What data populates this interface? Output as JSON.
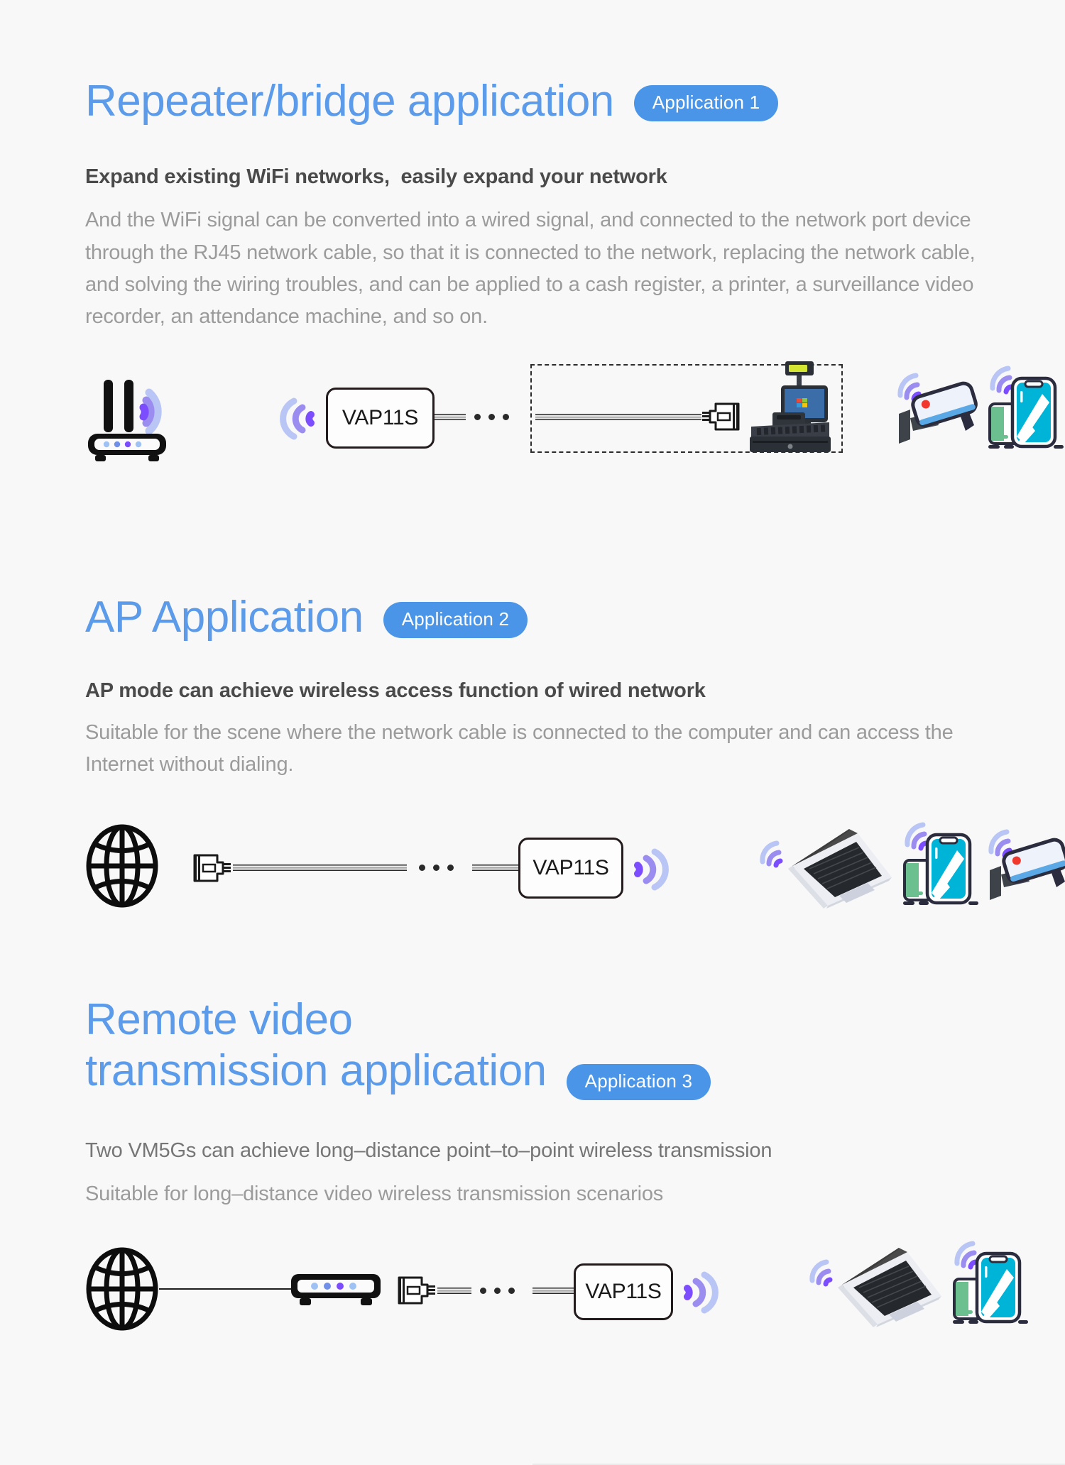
{
  "page": {
    "background": "#f8f8f8",
    "accent_blue": "#5b9bea",
    "badge_blue": "#4a95e8",
    "wifi_inner": "#7c4dff",
    "wifi_mid": "#9b8cf0",
    "wifi_outer": "#b8c5f5"
  },
  "sections": [
    {
      "id": "repeater-bridge",
      "title": "Repeater/bridge application",
      "badge": "Application 1",
      "subtitle": "Expand existing WiFi networks,  easily expand your network",
      "body": "And the WiFi signal can be converted into a wired signal, and connected to the network port device through the RJ45 network cable, so that it is connected to the network, replacing the network cable, and solving the wiring troubles, and can be applied to a cash register, a printer, a surveillance video recorder, an attendance machine, and so on.",
      "diagram": {
        "device_label": "VAP11S",
        "nodes": [
          "router-icon",
          "wifi-signal-icon",
          "vap11s-device",
          "ethernet-cable",
          "ellipsis-separator",
          "rj45-connector",
          "cash-register-icon",
          "cctv-camera-icon",
          "smartphone-icon"
        ]
      }
    },
    {
      "id": "ap-application",
      "title": "AP Application",
      "badge": "Application 2",
      "subtitle": "AP mode can achieve wireless access function of wired network",
      "body": "Suitable for the scene where the network cable is connected to the computer and can access the Internet without dialing.",
      "diagram": {
        "device_label": "VAP11S",
        "nodes": [
          "globe-icon",
          "rj45-connector",
          "ethernet-cable",
          "ellipsis-separator",
          "vap11s-device",
          "wifi-signal-icon",
          "laptop-icon",
          "smartphone-icon",
          "cctv-camera-icon"
        ]
      }
    },
    {
      "id": "remote-video",
      "title_line1": "Remote video",
      "title_line2": "transmission application",
      "badge": "Application 3",
      "subtitle": "Two VM5Gs can achieve long–distance point–to–point wireless transmission",
      "body": "Suitable for long–distance video wireless transmission scenarios",
      "diagram": {
        "device_label": "VAP11S",
        "nodes": [
          "globe-icon",
          "connection-line",
          "modem-icon",
          "rj45-connector",
          "ethernet-cable",
          "ellipsis-separator",
          "vap11s-device",
          "wifi-signal-icon",
          "laptop-icon",
          "smartphone-icon"
        ]
      }
    }
  ]
}
